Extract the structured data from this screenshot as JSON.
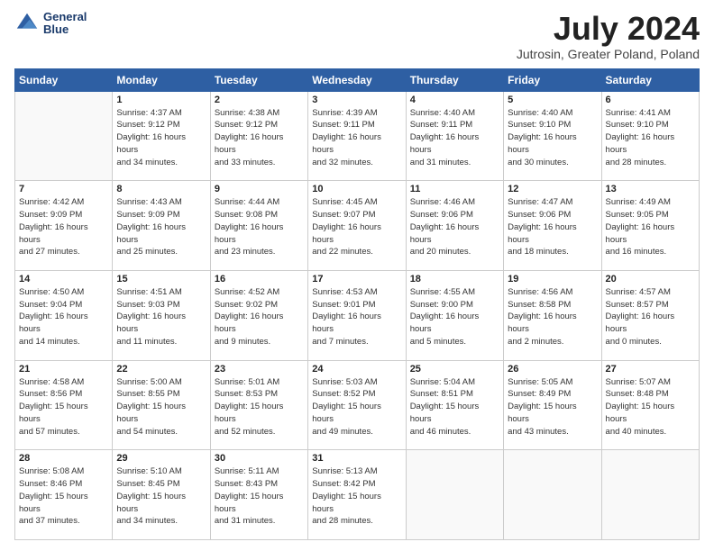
{
  "header": {
    "logo_line1": "General",
    "logo_line2": "Blue",
    "month_title": "July 2024",
    "location": "Jutrosin, Greater Poland, Poland"
  },
  "days_of_week": [
    "Sunday",
    "Monday",
    "Tuesday",
    "Wednesday",
    "Thursday",
    "Friday",
    "Saturday"
  ],
  "weeks": [
    [
      {
        "day": "",
        "empty": true
      },
      {
        "day": "1",
        "sunrise": "4:37 AM",
        "sunset": "9:12 PM",
        "daylight": "16 hours and 34 minutes."
      },
      {
        "day": "2",
        "sunrise": "4:38 AM",
        "sunset": "9:12 PM",
        "daylight": "16 hours and 33 minutes."
      },
      {
        "day": "3",
        "sunrise": "4:39 AM",
        "sunset": "9:11 PM",
        "daylight": "16 hours and 32 minutes."
      },
      {
        "day": "4",
        "sunrise": "4:40 AM",
        "sunset": "9:11 PM",
        "daylight": "16 hours and 31 minutes."
      },
      {
        "day": "5",
        "sunrise": "4:40 AM",
        "sunset": "9:10 PM",
        "daylight": "16 hours and 30 minutes."
      },
      {
        "day": "6",
        "sunrise": "4:41 AM",
        "sunset": "9:10 PM",
        "daylight": "16 hours and 28 minutes."
      }
    ],
    [
      {
        "day": "7",
        "sunrise": "4:42 AM",
        "sunset": "9:09 PM",
        "daylight": "16 hours and 27 minutes."
      },
      {
        "day": "8",
        "sunrise": "4:43 AM",
        "sunset": "9:09 PM",
        "daylight": "16 hours and 25 minutes."
      },
      {
        "day": "9",
        "sunrise": "4:44 AM",
        "sunset": "9:08 PM",
        "daylight": "16 hours and 23 minutes."
      },
      {
        "day": "10",
        "sunrise": "4:45 AM",
        "sunset": "9:07 PM",
        "daylight": "16 hours and 22 minutes."
      },
      {
        "day": "11",
        "sunrise": "4:46 AM",
        "sunset": "9:06 PM",
        "daylight": "16 hours and 20 minutes."
      },
      {
        "day": "12",
        "sunrise": "4:47 AM",
        "sunset": "9:06 PM",
        "daylight": "16 hours and 18 minutes."
      },
      {
        "day": "13",
        "sunrise": "4:49 AM",
        "sunset": "9:05 PM",
        "daylight": "16 hours and 16 minutes."
      }
    ],
    [
      {
        "day": "14",
        "sunrise": "4:50 AM",
        "sunset": "9:04 PM",
        "daylight": "16 hours and 14 minutes."
      },
      {
        "day": "15",
        "sunrise": "4:51 AM",
        "sunset": "9:03 PM",
        "daylight": "16 hours and 11 minutes."
      },
      {
        "day": "16",
        "sunrise": "4:52 AM",
        "sunset": "9:02 PM",
        "daylight": "16 hours and 9 minutes."
      },
      {
        "day": "17",
        "sunrise": "4:53 AM",
        "sunset": "9:01 PM",
        "daylight": "16 hours and 7 minutes."
      },
      {
        "day": "18",
        "sunrise": "4:55 AM",
        "sunset": "9:00 PM",
        "daylight": "16 hours and 5 minutes."
      },
      {
        "day": "19",
        "sunrise": "4:56 AM",
        "sunset": "8:58 PM",
        "daylight": "16 hours and 2 minutes."
      },
      {
        "day": "20",
        "sunrise": "4:57 AM",
        "sunset": "8:57 PM",
        "daylight": "16 hours and 0 minutes."
      }
    ],
    [
      {
        "day": "21",
        "sunrise": "4:58 AM",
        "sunset": "8:56 PM",
        "daylight": "15 hours and 57 minutes."
      },
      {
        "day": "22",
        "sunrise": "5:00 AM",
        "sunset": "8:55 PM",
        "daylight": "15 hours and 54 minutes."
      },
      {
        "day": "23",
        "sunrise": "5:01 AM",
        "sunset": "8:53 PM",
        "daylight": "15 hours and 52 minutes."
      },
      {
        "day": "24",
        "sunrise": "5:03 AM",
        "sunset": "8:52 PM",
        "daylight": "15 hours and 49 minutes."
      },
      {
        "day": "25",
        "sunrise": "5:04 AM",
        "sunset": "8:51 PM",
        "daylight": "15 hours and 46 minutes."
      },
      {
        "day": "26",
        "sunrise": "5:05 AM",
        "sunset": "8:49 PM",
        "daylight": "15 hours and 43 minutes."
      },
      {
        "day": "27",
        "sunrise": "5:07 AM",
        "sunset": "8:48 PM",
        "daylight": "15 hours and 40 minutes."
      }
    ],
    [
      {
        "day": "28",
        "sunrise": "5:08 AM",
        "sunset": "8:46 PM",
        "daylight": "15 hours and 37 minutes."
      },
      {
        "day": "29",
        "sunrise": "5:10 AM",
        "sunset": "8:45 PM",
        "daylight": "15 hours and 34 minutes."
      },
      {
        "day": "30",
        "sunrise": "5:11 AM",
        "sunset": "8:43 PM",
        "daylight": "15 hours and 31 minutes."
      },
      {
        "day": "31",
        "sunrise": "5:13 AM",
        "sunset": "8:42 PM",
        "daylight": "15 hours and 28 minutes."
      },
      {
        "day": "",
        "empty": true
      },
      {
        "day": "",
        "empty": true
      },
      {
        "day": "",
        "empty": true
      }
    ]
  ]
}
